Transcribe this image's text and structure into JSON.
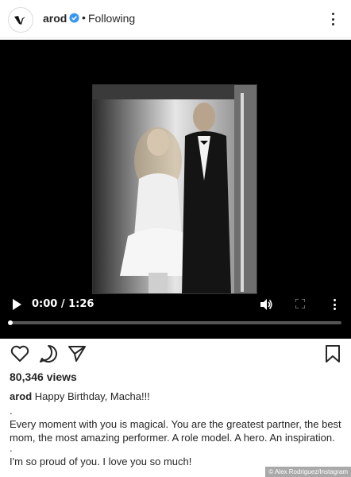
{
  "header": {
    "username": "arod",
    "follow_status": "Following",
    "separator": "•"
  },
  "video": {
    "time": "0:00 / 1:26",
    "progress_fraction": 0.0
  },
  "post": {
    "views": "80,346 views",
    "caption_user": "arod",
    "caption_lines": [
      "Happy Birthday, Macha!!!",
      ".",
      "Every moment with you is magical. You are the greatest partner, the best mom, the most amazing performer. A role model. A hero. An inspiration.",
      ".",
      "I'm so proud of you. I love you so much!"
    ]
  },
  "credit": "© Alex Rodriguez/Instagram",
  "colors": {
    "text": "#262626",
    "verified": "#3897f0",
    "video_bg": "#000000"
  },
  "icons": {
    "header": [
      "avatar-logo-icon",
      "verified-badge-icon",
      "more-options-icon"
    ],
    "video": [
      "play-icon",
      "volume-icon",
      "fullscreen-icon",
      "video-more-icon"
    ],
    "actions": [
      "heart-icon",
      "comment-icon",
      "share-icon",
      "bookmark-icon"
    ]
  }
}
